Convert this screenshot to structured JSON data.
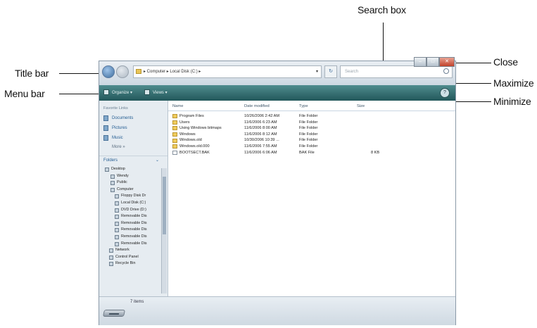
{
  "callouts": {
    "search_box": "Search box",
    "title_bar": "Title bar",
    "menu_bar": "Menu bar",
    "close": "Close",
    "maximize": "Maximize",
    "minimize": "Minimize"
  },
  "window": {
    "address": "▸  Computer  ▸  Local Disk (C:)  ▸",
    "address_dropdown": "▾",
    "refresh": "↻",
    "search_placeholder": "Search",
    "menu": {
      "organize": "Organize ▾",
      "views": "Views ▾"
    },
    "sidebar": {
      "favorite_links_label": "Favorite Links",
      "favorites": [
        "Documents",
        "Pictures",
        "Music"
      ],
      "more": "More »",
      "folders_label": "Folders",
      "folders_arrow": "⌄",
      "tree": [
        "Desktop",
        "Wendy",
        "Public",
        "Computer",
        "Floppy Disk Dr",
        "Local Disk (C:)",
        "DVD Drive (D:)",
        "Removable Dis",
        "Removable Dis",
        "Removable Dis",
        "Removable Dis",
        "Removable Dis",
        "Network",
        "Control Panel",
        "Recycle Bin"
      ]
    },
    "columns": [
      "Name",
      "Date modified",
      "Type",
      "Size"
    ],
    "files": [
      {
        "name": "Program Files",
        "date": "10/26/2006 2:42 AM",
        "type": "File Folder",
        "size": ""
      },
      {
        "name": "Users",
        "date": "11/6/2006 6:23 AM",
        "type": "File Folder",
        "size": ""
      },
      {
        "name": "Using Windows bitmaps",
        "date": "11/6/2006 8:00 AM",
        "type": "File Folder",
        "size": ""
      },
      {
        "name": "Windows",
        "date": "11/6/2006 8:12 AM",
        "type": "File Folder",
        "size": ""
      },
      {
        "name": "Windows.old",
        "date": "10/30/2006 10:39 ...",
        "type": "File Folder",
        "size": ""
      },
      {
        "name": "Windows.old.000",
        "date": "11/6/2006 7:55 AM",
        "type": "File Folder",
        "size": ""
      },
      {
        "name": "BOOTSECT.BAK",
        "date": "11/6/2006 6:06 AM",
        "type": "BAK File",
        "size": "8 KB"
      }
    ],
    "status": "7 items"
  }
}
